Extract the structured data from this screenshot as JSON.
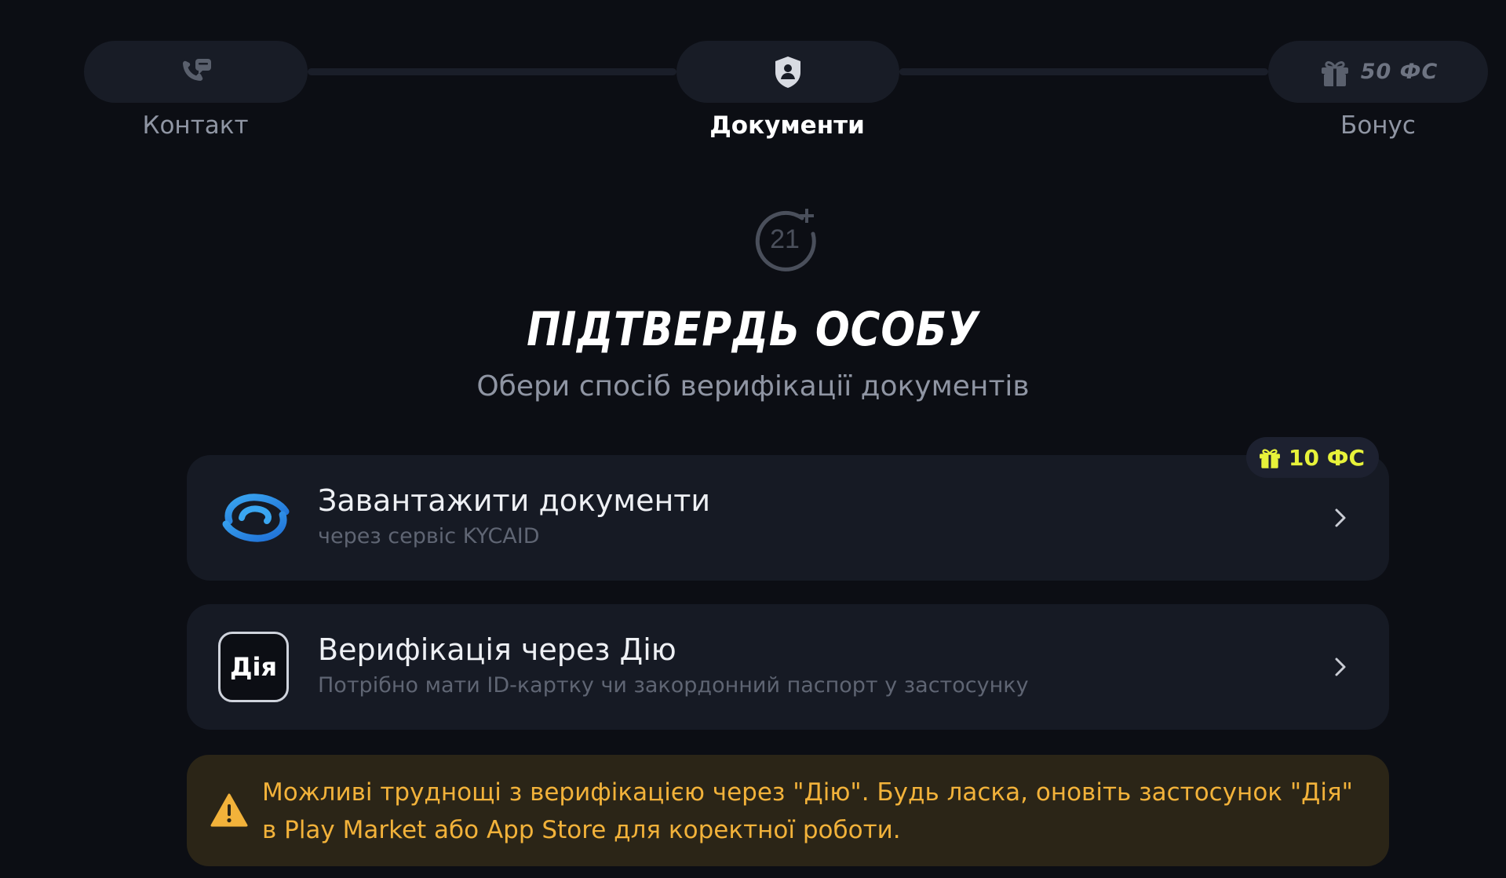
{
  "stepper": {
    "steps": [
      {
        "label": "Контакт",
        "icon": "phone-chat-icon",
        "state": "done"
      },
      {
        "label": "Документи",
        "icon": "shield-user-icon",
        "state": "active"
      },
      {
        "label": "Бонус",
        "icon": "gift-icon",
        "state": "upcoming",
        "amount": "50 ФС"
      }
    ]
  },
  "hero": {
    "icon": "age-21-plus-icon",
    "title": "ПІДТВЕРДЬ ОСОБУ",
    "subtitle": "Обери спосіб верифікації документів"
  },
  "options": [
    {
      "title": "Завантажити документи",
      "subtitle": "через сервіс KYCAID",
      "logo": "kycaid-logo",
      "badge": "10 ФС"
    },
    {
      "title": "Верифікація через Дію",
      "subtitle": "Потрібно мати ID-картку чи закордонний паспорт у застосунку",
      "logo_text": "Дія"
    }
  ],
  "warning": {
    "icon": "warning-triangle-icon",
    "text": "Можливі труднощі з верифікацією через \"Дію\". Будь ласка, оновіть застосунок \"Дія\" в Play Market або App Store для коректної роботи."
  },
  "colors": {
    "background": "#0c0e14",
    "card": "#161a24",
    "accent_yellow": "#e7f23a",
    "warning_text": "#f2b23a",
    "warning_bg": "#2b2517"
  }
}
